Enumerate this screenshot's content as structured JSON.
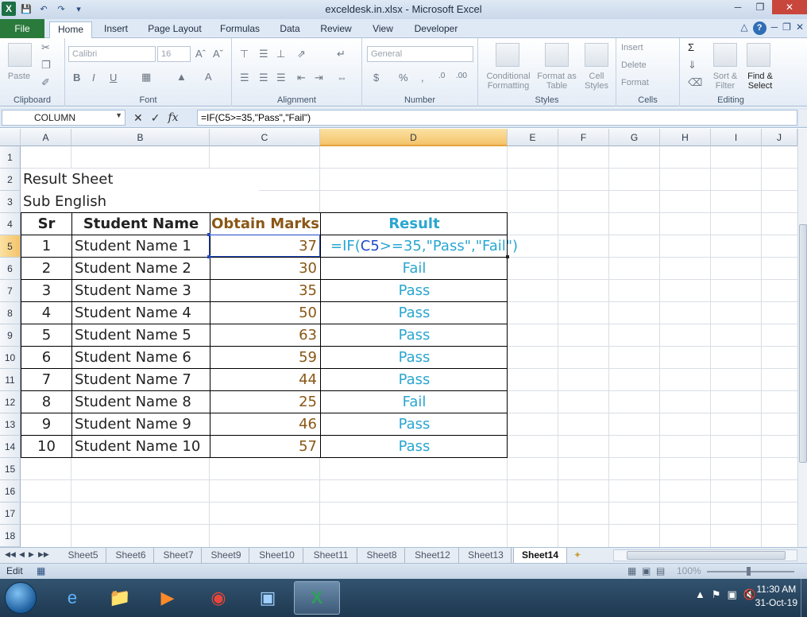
{
  "window": {
    "title": "exceldesk.in.xlsx - Microsoft Excel",
    "controls": {
      "minimize": "─",
      "maximize": "❐",
      "close": "✕"
    }
  },
  "ribbon_tabs": [
    "File",
    "Home",
    "Insert",
    "Page Layout",
    "Formulas",
    "Data",
    "Review",
    "View",
    "Developer"
  ],
  "ribbon": {
    "clipboard": {
      "label": "Clipboard",
      "paste": "Paste"
    },
    "font": {
      "label": "Font",
      "name": "Calibri",
      "size": "16",
      "bold": "B",
      "italic": "I",
      "underline": "U"
    },
    "alignment": {
      "label": "Alignment"
    },
    "number": {
      "label": "Number",
      "format": "General",
      "currency": "$",
      "percent": "%",
      "comma": ","
    },
    "styles": {
      "label": "Styles",
      "conditional": "Conditional Formatting",
      "format_table": "Format as Table",
      "cell_styles": "Cell Styles"
    },
    "cells": {
      "label": "Cells",
      "insert": "Insert",
      "delete": "Delete",
      "format": "Format"
    },
    "editing": {
      "label": "Editing",
      "sum": "Σ",
      "sort_filter": "Sort & Filter",
      "find_select": "Find & Select"
    }
  },
  "formula_bar": {
    "name_box": "COLUMN",
    "fx": "fx",
    "formula": "=IF(C5>=35,\"Pass\",\"Fail\")"
  },
  "grid": {
    "columns": [
      "A",
      "B",
      "C",
      "D",
      "E",
      "F",
      "G",
      "H",
      "I",
      "J"
    ],
    "rows": [
      "1",
      "2",
      "3",
      "4",
      "5",
      "6",
      "7",
      "8",
      "9",
      "10",
      "11",
      "12",
      "13",
      "14",
      "15",
      "16",
      "17",
      "18"
    ],
    "title": "Result Sheet",
    "subtitle": "Sub English",
    "headers": {
      "sr": "Sr",
      "name": "Student Name",
      "marks": "Obtain Marks",
      "result": "Result"
    },
    "editing_formula": {
      "prefix": "=IF(",
      "ref": "C5",
      "suffix": ">=35,\"Pass\",\"Fail\")"
    },
    "records": [
      {
        "sr": "1",
        "name": "Student Name 1",
        "marks": "37",
        "result": ""
      },
      {
        "sr": "2",
        "name": "Student Name 2",
        "marks": "30",
        "result": "Fail"
      },
      {
        "sr": "3",
        "name": "Student Name 3",
        "marks": "35",
        "result": "Pass"
      },
      {
        "sr": "4",
        "name": "Student Name 4",
        "marks": "50",
        "result": "Pass"
      },
      {
        "sr": "5",
        "name": "Student Name 5",
        "marks": "63",
        "result": "Pass"
      },
      {
        "sr": "6",
        "name": "Student Name 6",
        "marks": "59",
        "result": "Pass"
      },
      {
        "sr": "7",
        "name": "Student Name 7",
        "marks": "44",
        "result": "Pass"
      },
      {
        "sr": "8",
        "name": "Student Name 8",
        "marks": "25",
        "result": "Fail"
      },
      {
        "sr": "9",
        "name": "Student Name 9",
        "marks": "46",
        "result": "Pass"
      },
      {
        "sr": "10",
        "name": "Student Name 10",
        "marks": "57",
        "result": "Pass"
      }
    ]
  },
  "sheet_tabs": [
    "Sheet5",
    "Sheet6",
    "Sheet7",
    "Sheet9",
    "Sheet10",
    "Sheet11",
    "Sheet8",
    "Sheet12",
    "Sheet13",
    "Sheet14"
  ],
  "active_sheet": "Sheet14",
  "status": {
    "mode": "Edit",
    "zoom": "100%"
  },
  "taskbar": {
    "time": "11:30 AM",
    "date": "31-Oct-19"
  },
  "colors": {
    "accent_file": "#2a7a3b",
    "marks_text": "#8a5716",
    "result_text": "#2aa6d0",
    "ref_blue": "#2149c7"
  }
}
